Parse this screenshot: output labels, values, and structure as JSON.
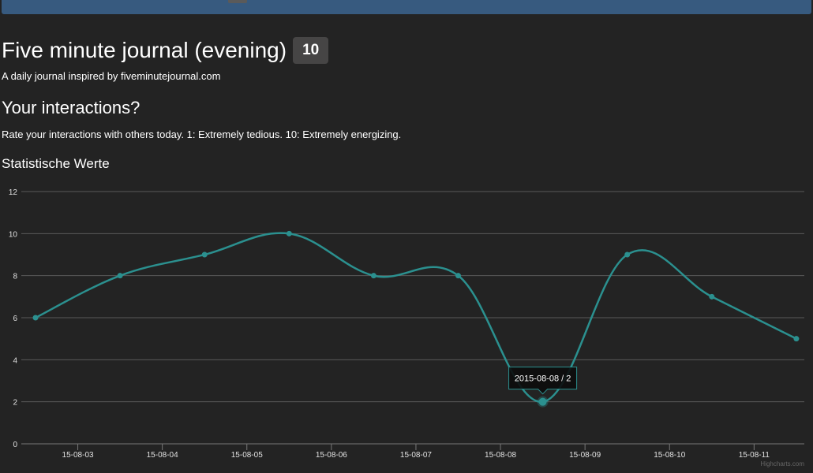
{
  "header": {
    "title": "Five minute journal (evening)",
    "badge": "10",
    "subtitle": "A daily journal inspired by fiveminutejournal.com"
  },
  "section": {
    "title": "Your interactions?",
    "description": "Rate your interactions with others today. 1: Extremely tedious. 10: Extremely energizing."
  },
  "chart_data": {
    "type": "line",
    "title": "Statistische Werte",
    "x": [
      "2015-08-02",
      "2015-08-03",
      "2015-08-04",
      "2015-08-05",
      "2015-08-06",
      "2015-08-07",
      "2015-08-08",
      "2015-08-09",
      "2015-08-10",
      "2015-08-11"
    ],
    "y": [
      6,
      8,
      9,
      10,
      8,
      8,
      2,
      9,
      7,
      5
    ],
    "xtick_labels": [
      "15-08-03",
      "15-08-04",
      "15-08-05",
      "15-08-06",
      "15-08-07",
      "15-08-08",
      "15-08-09",
      "15-08-10",
      "15-08-11"
    ],
    "yticks": [
      0,
      2,
      4,
      6,
      8,
      10,
      12
    ],
    "ylim": [
      0,
      12
    ],
    "grid": true,
    "line_color": "#2b908f",
    "tooltip": {
      "text": "2015-08-08 / 2",
      "point_index": 6
    },
    "credits": "Highcharts.com"
  }
}
